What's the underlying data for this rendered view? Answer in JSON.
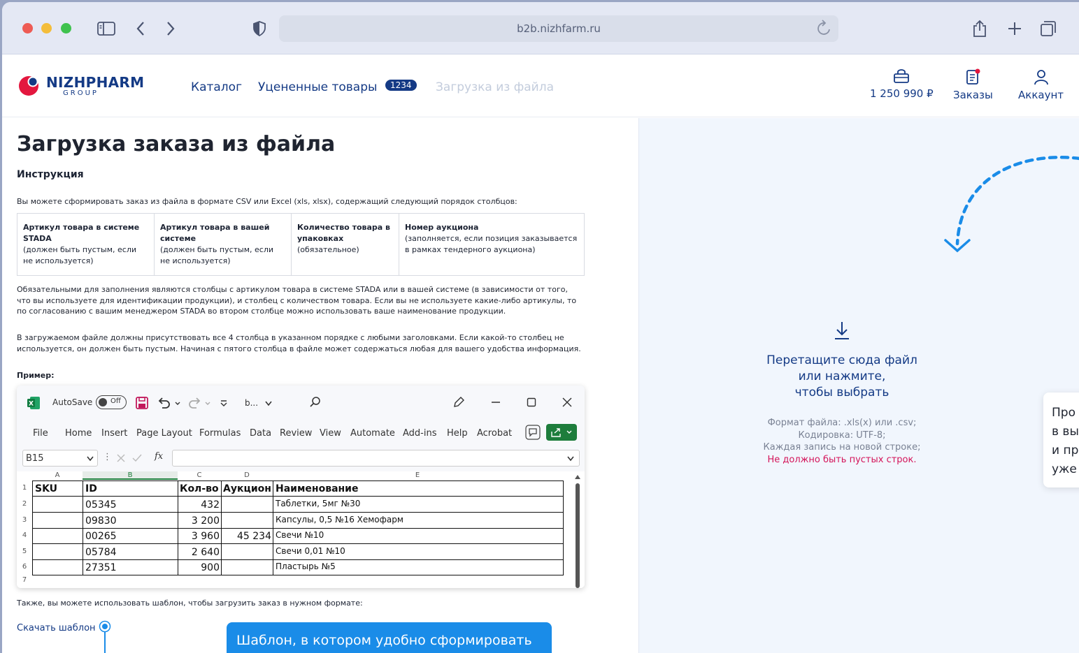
{
  "browser": {
    "url": "b2b.nizhfarm.ru"
  },
  "logo": {
    "brand": "NIZHPHARM",
    "sub": "GROUP"
  },
  "nav": {
    "catalog": "Каталог",
    "discounted": "Уцененные товары",
    "discounted_badge": "1234",
    "upload": "Загрузка из файла"
  },
  "header": {
    "cart_total": "1 250 990 ₽",
    "orders": "Заказы",
    "account": "Аккаунт"
  },
  "page": {
    "title": "Загрузка заказа из файла",
    "instruction_heading": "Инструкция",
    "intro": "Вы можете сформировать заказ из файла в формате CSV или Excel (xls, xlsx), содержащий следующий порядок столбцов:",
    "columns": [
      {
        "title": "Артикул товара в системе STADA",
        "note": "(должен быть пустым, если не используется)"
      },
      {
        "title": "Артикул товара в вашей системе",
        "note": "(должен быть пустым, если не используется)"
      },
      {
        "title": "Количество товара в упаковках",
        "note": "(обязательное)"
      },
      {
        "title": "Номер аукциона",
        "note": "(заполняется, если позиция заказывается в рамках тендерного аукциона)"
      }
    ],
    "para1": "Обязательными для заполнения являются столбцы с артикулом товара в системе STADA или в вашей системе (в зависимости от того, что вы используете для идентификации продукции), и столбец с количеством товара. Если вы не используете какие-либо артикулы, то по согласованию с вашим менеджером STADA во втором столбце можно использовать ваше наименование продукции.",
    "para2": "В загружаемом файле должны присутствовать все 4 столбца в указанном порядке с любыми заголовками. Если какой-то столбец не используется, он должен быть пустым. Начиная с пятого столбца в файле может содержаться любая для вашего удобства информация.",
    "example_label": "Пример:",
    "template_text": "Также, вы можете использовать шаблон, чтобы загрузить заказ в нужном формате:",
    "download_link": "Скачать шаблон",
    "tooltip": "Шаблон, в котором удобно сформировать"
  },
  "excel": {
    "autosave": "AutoSave",
    "autosave_state": "Off",
    "filename": "b...",
    "menu": [
      "File",
      "Home",
      "Insert",
      "Page Layout",
      "Formulas",
      "Data",
      "Review",
      "View",
      "Automate",
      "Add-ins",
      "Help",
      "Acrobat"
    ],
    "namebox": "B15",
    "fx": "fx",
    "col_letters": [
      "A",
      "B",
      "C",
      "D",
      "E"
    ],
    "row_numbers": [
      "1",
      "2",
      "3",
      "4",
      "5",
      "6",
      "7"
    ],
    "header_row": [
      "SKU",
      "ID",
      "Кол-во",
      "Аукцион",
      "Наименование"
    ],
    "rows": [
      [
        "",
        "05345",
        "432",
        "",
        "Таблетки, 5мг №30"
      ],
      [
        "",
        "09830",
        "3 200",
        "",
        "Капсулы, 0,5 №16 Хемофарм"
      ],
      [
        "",
        "00265",
        "3 960",
        "45 234",
        "Свечи №10"
      ],
      [
        "",
        "05784",
        "2 640",
        "",
        "Свечи 0,01 №10"
      ],
      [
        "",
        "27351",
        "900",
        "",
        "Пластырь №5"
      ]
    ]
  },
  "dropzone": {
    "title_lines": [
      "Перетащите сюда файл",
      "или нажмите,",
      "чтобы выбрать"
    ],
    "format": "Формат файла: .xls(x) или .csv;",
    "encoding": "Кодировка: UTF-8;",
    "each_row": "Каждая запись на новой строке;",
    "warning": "Не должно быть пустых строк."
  },
  "side_card": {
    "lines": [
      "Про",
      "в вы",
      "и пр",
      "уже"
    ]
  },
  "colors": {
    "brand": "#143a85",
    "accent": "#1a8ce8",
    "warning": "#d4145a",
    "logo_red": "#e3173e"
  }
}
